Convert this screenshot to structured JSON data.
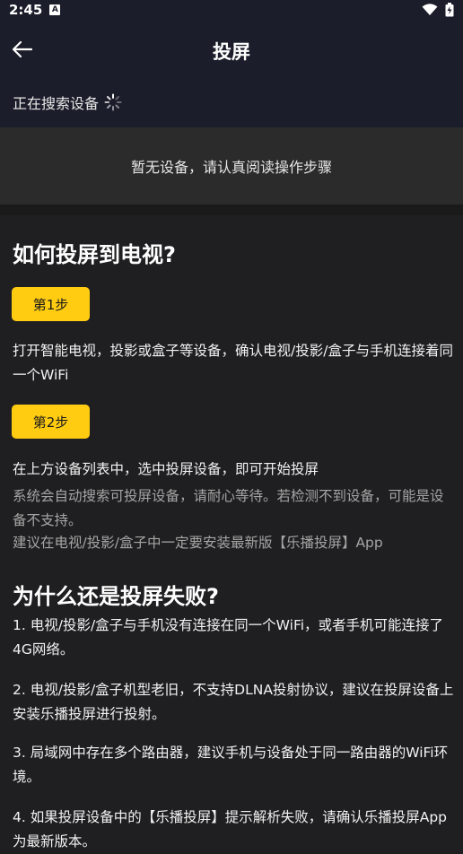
{
  "status": {
    "time": "2:45",
    "notification_badge": "A"
  },
  "header": {
    "title": "投屏",
    "back_icon": "arrow-left-icon"
  },
  "search": {
    "text": "正在搜索设备"
  },
  "empty": {
    "text": "暂无设备，请认真阅读操作步骤"
  },
  "guide": {
    "title": "如何投屏到电视?",
    "step1": {
      "label": "第1步",
      "desc": "打开智能电视，投影或盒子等设备，确认电视/投影/盒子与手机连接着同一个WiFi"
    },
    "step2": {
      "label": "第2步",
      "desc": "在上方设备列表中，选中投屏设备，即可开始投屏",
      "note1": "系统会自动搜索可投屏设备，请耐心等待。若检测不到设备，可能是设备不支持。",
      "note2": "建议在电视/投影/盒子中一定要安装最新版【乐播投屏】App"
    }
  },
  "faq": {
    "title": "为什么还是投屏失败?",
    "items": [
      "1. 电视/投影/盒子与手机没有连接在同一个WiFi，或者手机可能连接了4G网络。",
      " 2. 电视/投影/盒子机型老旧，不支持DLNA投射协议，建议在投屏设备上安装乐播投屏进行投射。",
      " 3. 局域网中存在多个路由器，建议手机与设备处于同一路由器的WiFi环境。",
      " 4. 如果投屏设备中的【乐播投屏】提示解析失败，请确认乐播投屏App为最新版本。"
    ]
  },
  "colors": {
    "accent": "#ffcc11",
    "header_bg": "#1b1d2a",
    "panel_bg": "#2b2b2b",
    "page_bg": "#1f1f21"
  }
}
